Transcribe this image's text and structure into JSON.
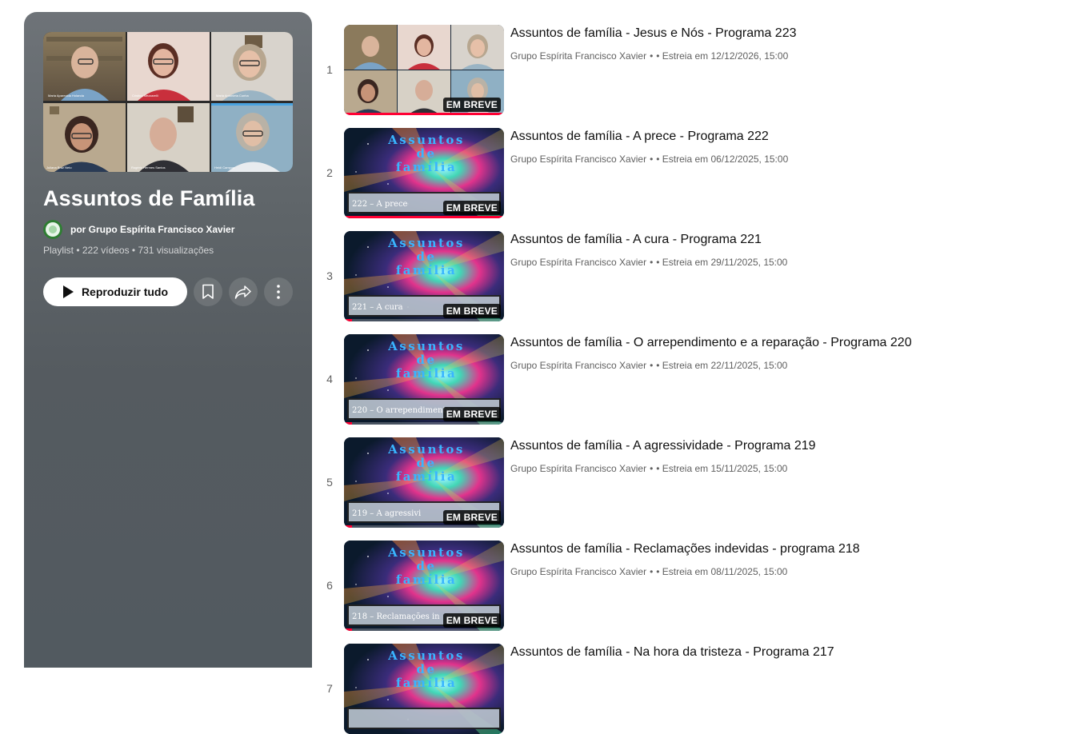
{
  "playlist": {
    "title": "Assuntos de Família",
    "owner": "por Grupo Espírita Francisco Xavier",
    "meta": "Playlist • 222 vídeos • 731 visualizações",
    "play_all_label": "Reproduzir tudo",
    "icons": {
      "save": "bookmark-icon",
      "share": "share-icon",
      "more": "more-vert-icon",
      "play": "play-icon"
    }
  },
  "colors": {
    "panel": "#5a6065",
    "progress": "#ff0033",
    "badge_bg": "#000000"
  },
  "videos": [
    {
      "index": "1",
      "title": "Assuntos de família - Jesus e Nós - Programa 223",
      "channel": "Grupo Espírita Francisco Xavier",
      "sep": "•",
      "premiere": "• Estreia em 12/12/2026, 15:00",
      "badge": "EM BREVE",
      "thumb_caption": "",
      "progress": 1.0
    },
    {
      "index": "2",
      "title": "Assuntos de família - A prece - Programa 222",
      "channel": "Grupo Espírita Francisco Xavier",
      "sep": "•",
      "premiere": "• Estreia em 06/12/2025, 15:00",
      "badge": "EM BREVE",
      "thumb_caption": "222 – A prece",
      "progress": 1.0
    },
    {
      "index": "3",
      "title": "Assuntos de família - A cura - Programa 221",
      "channel": "Grupo Espírita Francisco Xavier",
      "sep": "•",
      "premiere": "• Estreia em 29/11/2025, 15:00",
      "badge": "EM BREVE",
      "thumb_caption": "221 – A cura",
      "progress": 0.05
    },
    {
      "index": "4",
      "title": "Assuntos de família - O arrependimento e a reparação - Programa 220",
      "channel": "Grupo Espírita Francisco Xavier",
      "sep": "•",
      "premiere": "• Estreia em 22/11/2025, 15:00",
      "badge": "EM BREVE",
      "thumb_caption": "220 – O arrependimento e",
      "progress": 0.05
    },
    {
      "index": "5",
      "title": "Assuntos de família - A agressividade - Programa 219",
      "channel": "Grupo Espírita Francisco Xavier",
      "sep": "•",
      "premiere": "• Estreia em 15/11/2025, 15:00",
      "badge": "EM BREVE",
      "thumb_caption": "219 – A agressivi",
      "progress": 0.05
    },
    {
      "index": "6",
      "title": "Assuntos de família - Reclamações indevidas - programa 218",
      "channel": "Grupo Espírita Francisco Xavier",
      "sep": "•",
      "premiere": "• Estreia em 08/11/2025, 15:00",
      "badge": "EM BREVE",
      "thumb_caption": "218 – Reclamações in",
      "progress": 0.05
    },
    {
      "index": "7",
      "title": "Assuntos de família - Na hora da tristeza - Programa 217",
      "channel": "",
      "sep": "",
      "premiere": "",
      "badge": "",
      "thumb_caption": "",
      "progress": 0.0
    }
  ],
  "thumb_art": {
    "line1": "Assuntos",
    "line2": "de",
    "line3": "família"
  },
  "cover_tiles": [
    {
      "caption": "Maria Aparecida Holanda"
    },
    {
      "caption": "Cristina Mezzarelli"
    },
    {
      "caption": "Maria Antonieta Cunha"
    },
    {
      "caption": "Juliana Braz Neto"
    },
    {
      "caption": "Rogério Hermes Santos"
    },
    {
      "caption": "Heidi Campos"
    }
  ]
}
